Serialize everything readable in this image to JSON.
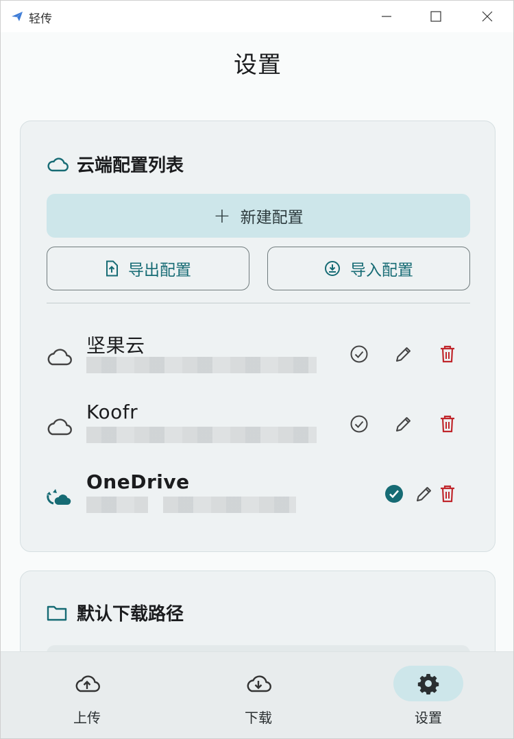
{
  "window": {
    "title": "轻传"
  },
  "page": {
    "title": "设置"
  },
  "cloud_card": {
    "title": "云端配置列表",
    "new_label": "新建配置",
    "export_label": "导出配置",
    "import_label": "导入配置",
    "items": [
      {
        "name": "坚果云",
        "icon": "cloud-outline-icon",
        "active": false
      },
      {
        "name": "Koofr",
        "icon": "cloud-outline-icon",
        "active": false
      },
      {
        "name": "OneDrive",
        "icon": "cloud-sync-icon",
        "active": true
      }
    ]
  },
  "download_card": {
    "title": "默认下载路径"
  },
  "nav": {
    "upload": "上传",
    "download": "下载",
    "settings": "设置",
    "active": "settings"
  },
  "colors": {
    "accent": "#166b74",
    "danger": "#c0262b",
    "active_pill": "#cde6ea",
    "card_bg": "#eef2f3"
  }
}
